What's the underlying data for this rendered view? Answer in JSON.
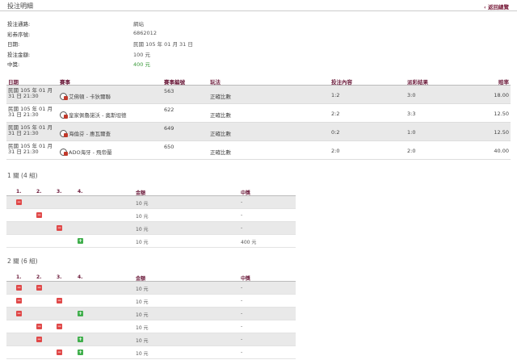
{
  "header": {
    "title": "投注明細",
    "back": "‹ 返回總覽"
  },
  "summary": [
    {
      "label": "投注通路:",
      "value": "網站",
      "green": false
    },
    {
      "label": "彩券序號:",
      "value": "6862012",
      "green": false
    },
    {
      "label": "日期:",
      "value": "民國 105 年 01 月 31 日",
      "green": false
    },
    {
      "label": "投注金額:",
      "value": "100 元",
      "green": false
    },
    {
      "label": "中獎:",
      "value": "400 元",
      "green": true
    }
  ],
  "bets_header": {
    "date": "日期",
    "match": "賽事",
    "code": "賽事編號",
    "play": "玩法",
    "pick": "投注內容",
    "result": "派彩結果",
    "odds": "賠率"
  },
  "bets": [
    {
      "date1": "民國 105 年 01 月",
      "date2": "31 日 21:30",
      "match": "艾佛頓 - 卡狄爾聯",
      "code": "563",
      "play": "正確比數",
      "pick": "1:2",
      "result": "3:0",
      "odds": "18.00"
    },
    {
      "date1": "民國 105 年 01 月",
      "date2": "31 日 21:30",
      "match": "皇家佩魯諾沃 - 奧斯坦德",
      "code": "622",
      "play": "正確比數",
      "pick": "2:2",
      "result": "3:3",
      "odds": "12.50"
    },
    {
      "date1": "民國 105 年 01 月",
      "date2": "31 日 21:30",
      "match": "海倫芬 - 惠瓦爾查",
      "code": "649",
      "play": "正確比數",
      "pick": "0:2",
      "result": "1:0",
      "odds": "12.50"
    },
    {
      "date1": "民國 105 年 01 月",
      "date2": "31 日 21:30",
      "match": "ADO海牙 - 飛帝蘭",
      "code": "650",
      "play": "正確比數",
      "pick": "2:0",
      "result": "2:0",
      "odds": "40.00"
    }
  ],
  "group_header": {
    "c1": "1.",
    "c2": "2.",
    "c3": "3.",
    "c4": "4.",
    "amount": "金額",
    "win": "中獎"
  },
  "groups": [
    {
      "title": "1 關 (4 組)",
      "rows": [
        {
          "marks": [
            "x",
            "",
            "",
            ""
          ],
          "amount": "10 元",
          "win": "-"
        },
        {
          "marks": [
            "",
            "x",
            "",
            ""
          ],
          "amount": "10 元",
          "win": "-"
        },
        {
          "marks": [
            "",
            "",
            "x",
            ""
          ],
          "amount": "10 元",
          "win": "-"
        },
        {
          "marks": [
            "",
            "",
            "",
            "o"
          ],
          "amount": "10 元",
          "win": "400 元"
        }
      ]
    },
    {
      "title": "2 關 (6 組)",
      "rows": [
        {
          "marks": [
            "x",
            "x",
            "",
            ""
          ],
          "amount": "10 元",
          "win": "-"
        },
        {
          "marks": [
            "x",
            "",
            "x",
            ""
          ],
          "amount": "10 元",
          "win": "-"
        },
        {
          "marks": [
            "x",
            "",
            "",
            "o"
          ],
          "amount": "10 元",
          "win": "-"
        },
        {
          "marks": [
            "",
            "x",
            "x",
            ""
          ],
          "amount": "10 元",
          "win": "-"
        },
        {
          "marks": [
            "",
            "x",
            "",
            "o"
          ],
          "amount": "10 元",
          "win": "-"
        },
        {
          "marks": [
            "",
            "",
            "x",
            "o"
          ],
          "amount": "10 元",
          "win": "-"
        }
      ]
    }
  ],
  "mark_symbols": {
    "x": "−",
    "o": "+"
  },
  "colors": {
    "accent": "#6b1a3a",
    "lose": "#e04848",
    "win": "#3fae4b",
    "win_text": "#3a9a3a"
  }
}
